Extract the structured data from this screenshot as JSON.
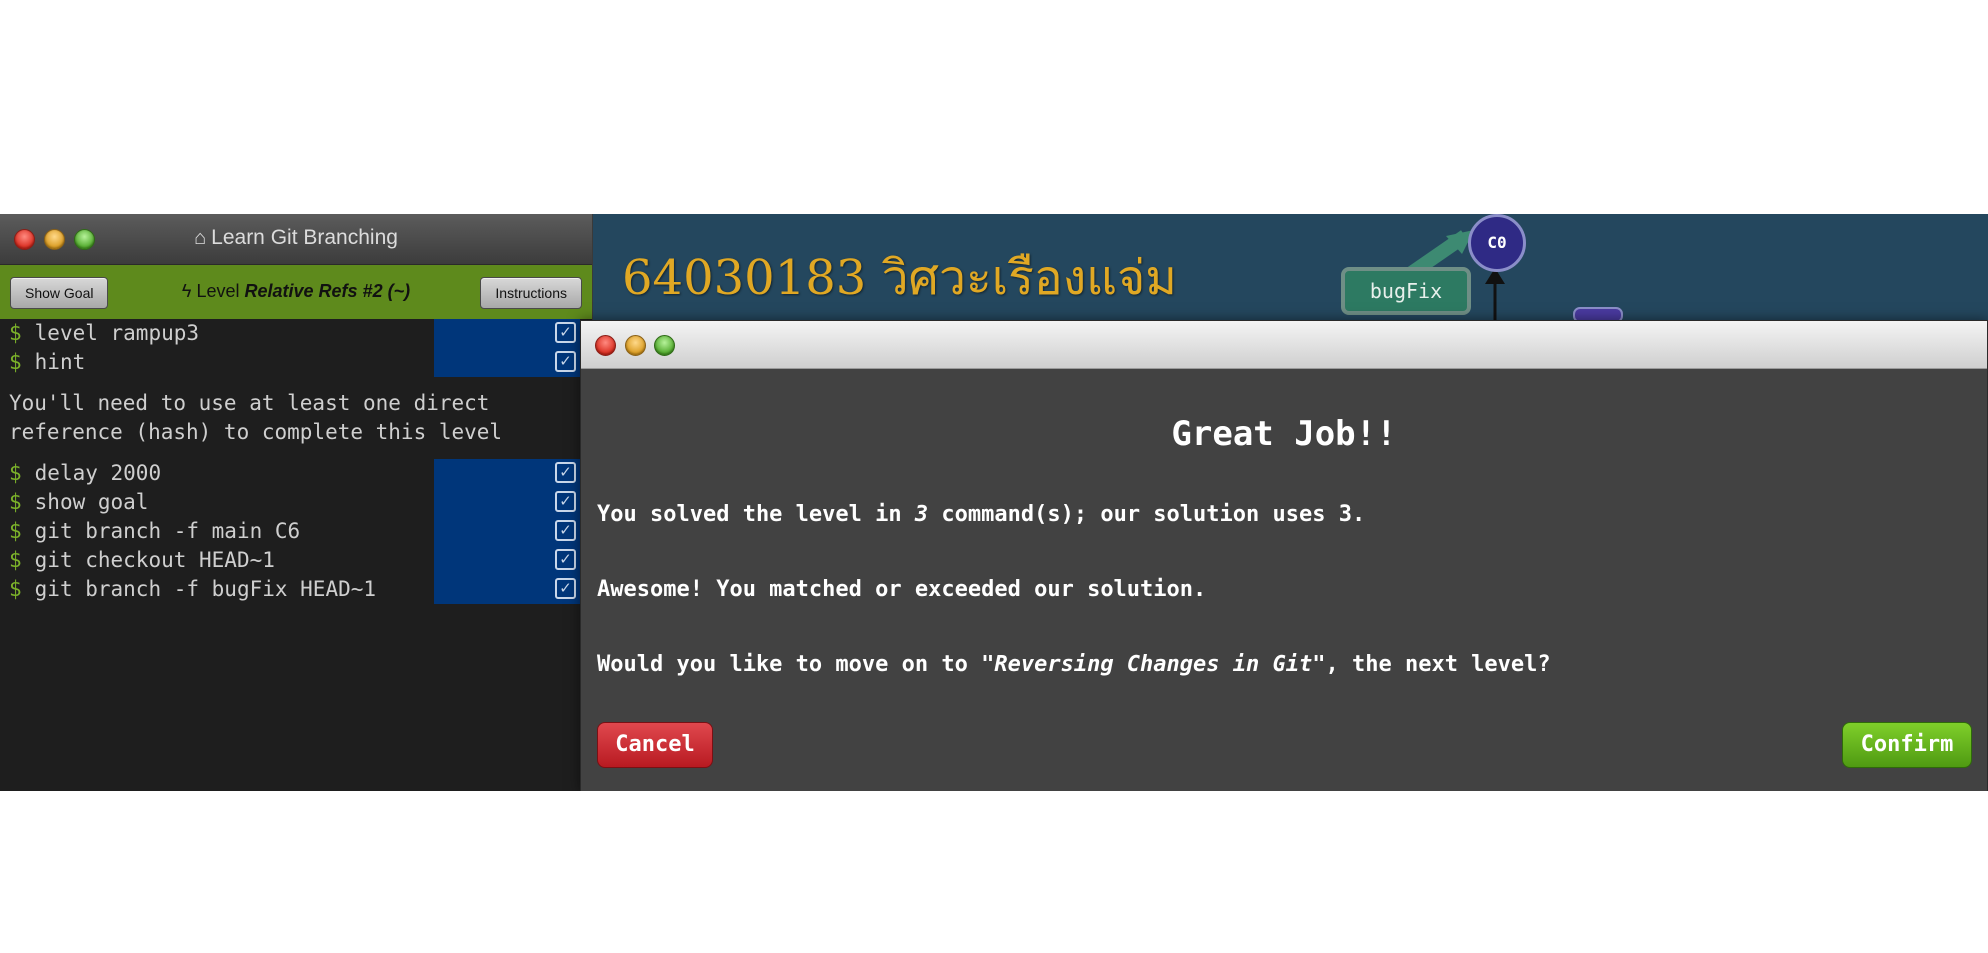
{
  "terminal": {
    "title": "Learn Git Branching",
    "show_goal_label": "Show Goal",
    "instructions_label": "Instructions",
    "level_prefix": "Level",
    "level_name": "Relative Refs #2 (~)",
    "prompt": "$",
    "commands_a": [
      "level rampup3",
      "hint"
    ],
    "hint": "You'll need to use at least one direct\nreference (hash) to complete this level",
    "commands_b": [
      "delay 2000",
      "show goal",
      "git branch -f main C6",
      "git checkout HEAD~1",
      "git branch -f bugFix HEAD~1"
    ]
  },
  "viz": {
    "title": "64030183 วิศวะเรืองแจ่ม",
    "node_label": "C0",
    "branch_label": "bugFix"
  },
  "dialog": {
    "heading": "Great Job!!",
    "solved_before": "You solved the level in ",
    "solved_count": "3",
    "solved_after": " command(s); our solution uses 3.",
    "awesome": "Awesome! You matched or exceeded our solution.",
    "next_before": "Would you like to move on to ",
    "next_level": "\"Reversing Changes in Git\"",
    "next_after": ", the next level?",
    "cancel_label": "Cancel",
    "confirm_label": "Confirm"
  },
  "colors": {
    "background": "#24475e",
    "title_gold": "#e0a824",
    "terminal_green": "#5e8a1c",
    "cancel_red": "#c8242b",
    "confirm_green": "#62b01a"
  }
}
